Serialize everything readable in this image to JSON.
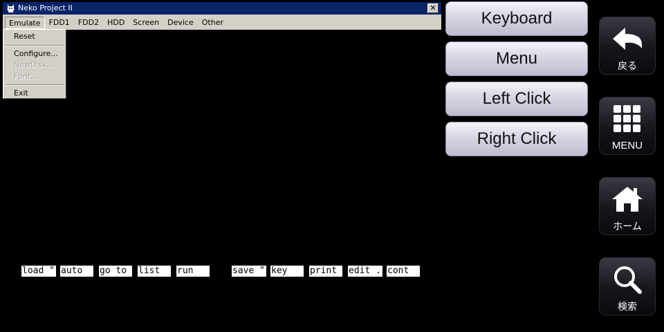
{
  "window": {
    "title": "Neko Project II",
    "close_label": "✕",
    "menu": [
      "Emulate",
      "FDD1",
      "FDD2",
      "HDD",
      "Screen",
      "Device",
      "Other"
    ]
  },
  "dropdown": {
    "items": [
      {
        "label": "Reset",
        "enabled": true
      },
      {
        "label": "Configure...",
        "enabled": true
      },
      {
        "label": "NewDisk...",
        "enabled": false
      },
      {
        "label": "Font...",
        "enabled": false
      },
      {
        "label": "Exit",
        "enabled": true
      }
    ]
  },
  "function_keys": [
    "load \"",
    "auto",
    "go to",
    "list",
    "run",
    "save \"",
    "key",
    "print",
    "edit .",
    "cont"
  ],
  "overlay_buttons": [
    "Keyboard",
    "Menu",
    "Left Click",
    "Right Click"
  ],
  "side_nav": {
    "back": "戻る",
    "menu": "MENU",
    "home": "ホーム",
    "search": "検索"
  }
}
